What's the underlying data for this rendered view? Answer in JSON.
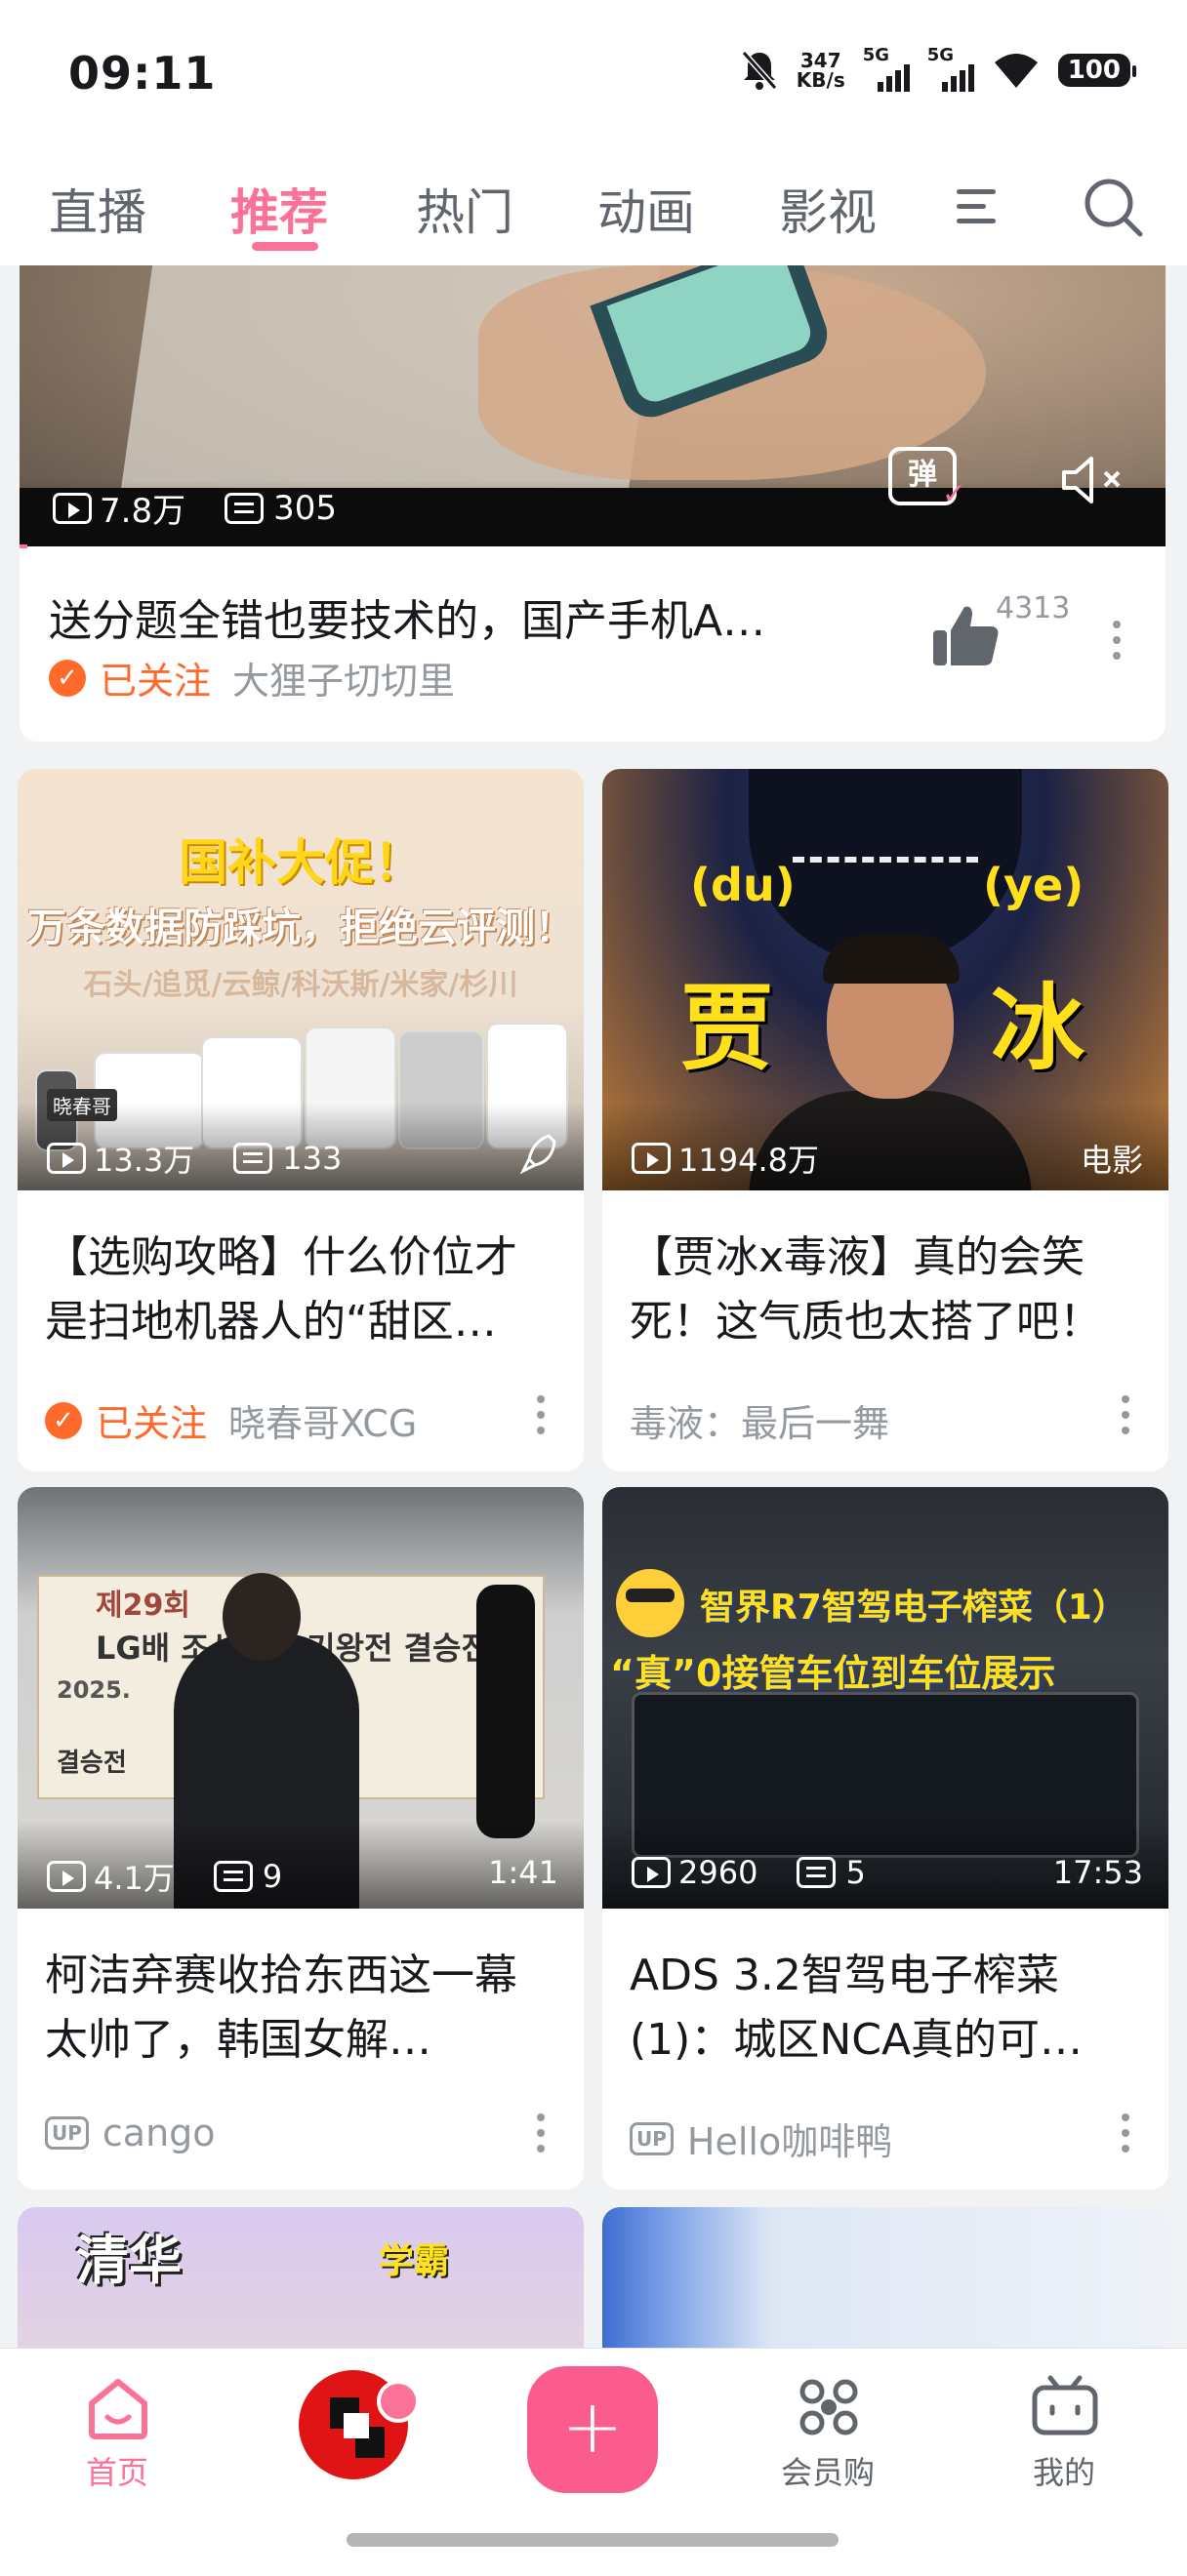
{
  "status": {
    "time": "09:11",
    "net_speed_value": "347",
    "net_speed_unit": "KB/s",
    "sim1": "5G",
    "sim2": "5G",
    "battery": "100"
  },
  "nav": {
    "tabs": [
      "直播",
      "推荐",
      "热门",
      "动画",
      "影视"
    ],
    "active_tab": "推荐"
  },
  "feature_card": {
    "views": "7.8万",
    "danmaku": "305",
    "danmaku_button": "弹",
    "title": "送分题全错也要技术的，国产手机A…",
    "followed_label": "已关注",
    "author": "大狸子切切里",
    "likes": "4313"
  },
  "cards": [
    {
      "views": "13.3万",
      "danmaku": "133",
      "title": "【选购攻略】什么价位才是扫地机器人的“甜区…",
      "followed_label": "已关注",
      "author": "晓春哥XCG",
      "thumb_text": [
        "国补大促！",
        "万条数据防踩坑，拒绝云评测！",
        "石头/追觅/云鲸/科沃斯/米家/杉川",
        "晓春哥"
      ]
    },
    {
      "views": "1194.8万",
      "tag": "电影",
      "title": "【贾冰x毒液】真的会笑死！这气质也太搭了吧！",
      "author": "毒液：最后一舞",
      "thumb_text": [
        "(du)",
        "(ye)",
        "贾",
        "冰"
      ]
    },
    {
      "views": "4.1万",
      "danmaku": "9",
      "duration": "1:41",
      "title": "柯洁弃赛收拾东西这一幕太帅了，韩国女解…",
      "up_badge": "UP",
      "author": "cango",
      "thumb_text": [
        "제29회",
        "LG배 조선일보 기왕전 결승전",
        "2025.",
        "결승전"
      ]
    },
    {
      "views": "2960",
      "danmaku": "5",
      "duration": "17:53",
      "title": "ADS 3.2智驾电子榨菜(1)：城区NCA真的可…",
      "up_badge": "UP",
      "author": "Hello咖啡鸭",
      "thumb_text": [
        "智界R7智驾电子榨菜（1）",
        "“真”0接管车位到车位展示"
      ]
    },
    {
      "thumb_text": [
        "清华",
        "学霸"
      ]
    },
    {}
  ],
  "bottom_nav": {
    "home": "首页",
    "vip": "会员购",
    "me": "我的",
    "plus": "+"
  },
  "colors": {
    "accent": "#fb7299",
    "follow": "#ff6a2a",
    "muted": "#9499a0"
  }
}
